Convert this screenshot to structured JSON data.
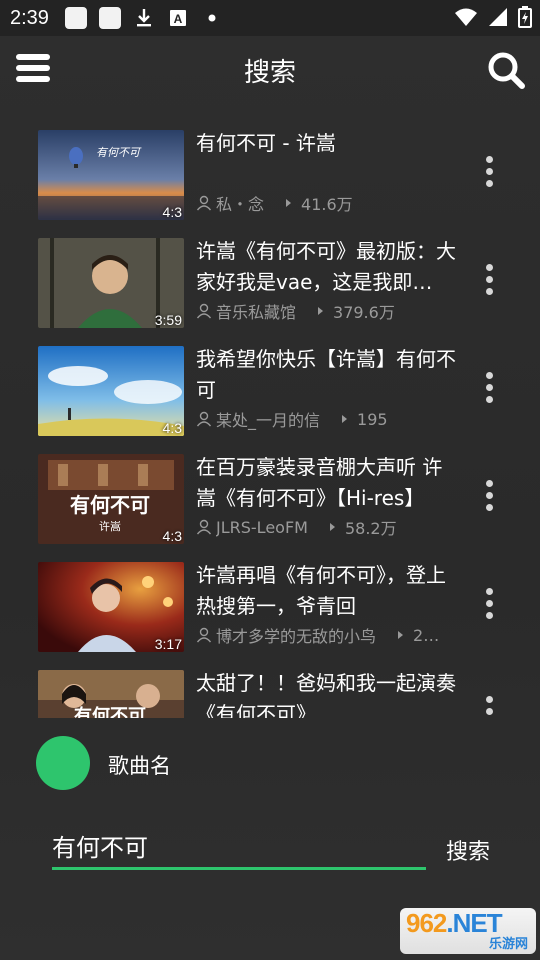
{
  "status_bar": {
    "time": "2:39",
    "icons": [
      "notification-square-icon",
      "notification-square-icon",
      "download-icon",
      "a-icon",
      "dot-icon",
      "wifi-icon",
      "signal-icon",
      "battery-icon"
    ]
  },
  "app_bar": {
    "title": "搜索",
    "menu_icon": "hamburger-menu-icon",
    "search_icon": "search-icon"
  },
  "videos": [
    {
      "title": "有何不可 - 许嵩",
      "author": "私・念",
      "views": "41.6万",
      "duration": "4:3"
    },
    {
      "title": "许嵩《有何不可》最初版：大家好我是vae，这是我即…",
      "author": "音乐私藏馆",
      "views": "379.6万",
      "duration": "3:59"
    },
    {
      "title": "我希望你快乐【许嵩】有何不可",
      "author": "某处_一月的信",
      "views": "195",
      "duration": "4:3"
    },
    {
      "title": "在百万豪装录音棚大声听 许嵩《有何不可》【Hi-res】",
      "author": "JLRS-LeoFM",
      "views": "58.2万",
      "duration": "4:3"
    },
    {
      "title": "许嵩再唱《有何不可》，登上热搜第一，爷青回",
      "author": "博才多学的无敌的小鸟",
      "views": "2…",
      "duration": "3:17"
    },
    {
      "title": "太甜了！！爸妈和我一起演奏《有何不可》",
      "author": "",
      "views": "",
      "duration": ""
    }
  ],
  "song": {
    "label": "歌曲名"
  },
  "search": {
    "value": "有何不可",
    "button_label": "搜索"
  },
  "watermark": {
    "main": "962",
    "net": ".NET",
    "sub": "乐游网"
  },
  "thumb_texts": [
    "有何不可",
    "许嵩",
    "有何不可"
  ],
  "colors": {
    "accent": "#2ec56d",
    "background": "#2b2b2b",
    "meta_text": "#9a9a9a"
  }
}
